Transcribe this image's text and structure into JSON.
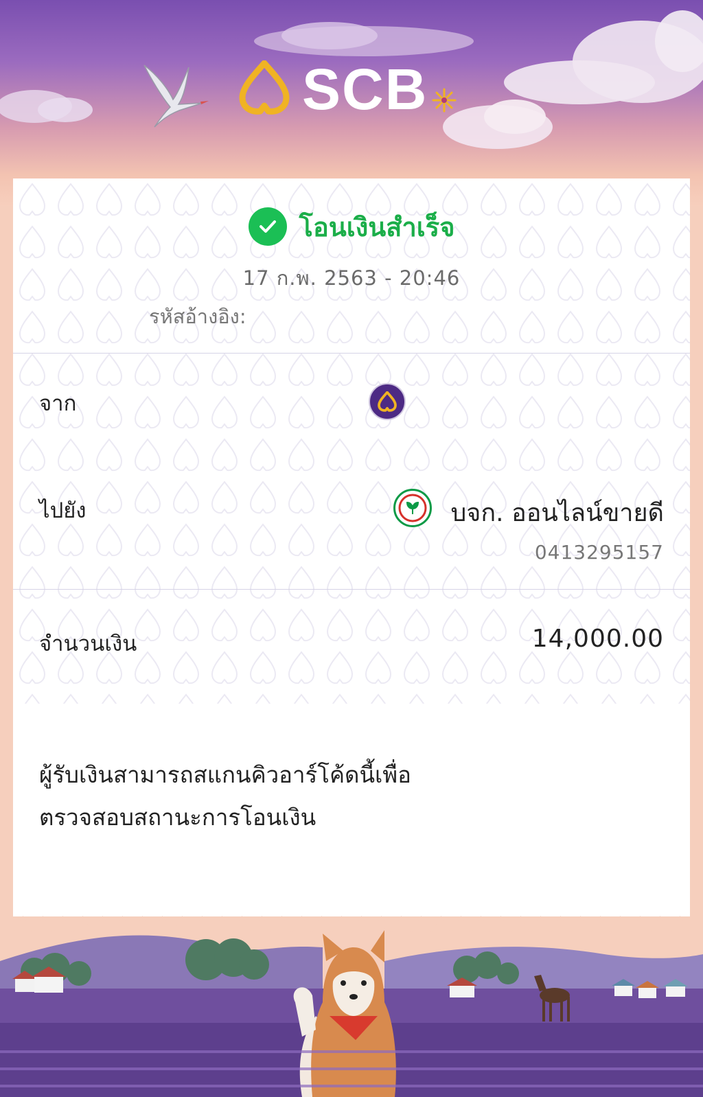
{
  "header": {
    "brand": "SCB",
    "colors": {
      "brand_purple": "#4d2a84",
      "brand_gold": "#f0b323",
      "sky_top": "#7a4fb0",
      "peach": "#f6cfbd"
    }
  },
  "receipt": {
    "status": "โอนเงินสำเร็จ",
    "status_color": "#1bae49",
    "datetime": "17 ก.พ. 2563 - 20:46",
    "reference_label": "รหัสอ้างอิง:",
    "from": {
      "label": "จาก",
      "bank_icon": "scb-logo-icon"
    },
    "to": {
      "label": "ไปยัง",
      "bank_icon": "kbank-logo-icon",
      "name": "บจก. ออนไลน์ขายดี",
      "account": "0413295157"
    },
    "amount": {
      "label": "จำนวนเงิน",
      "value": "14,000.00"
    },
    "qr_note_line1": "ผู้รับเงินสามารถสแกนคิวอาร์โค้ดนี้เพื่อ",
    "qr_note_line2": "ตรวจสอบสถานะการโอนเงิน"
  }
}
